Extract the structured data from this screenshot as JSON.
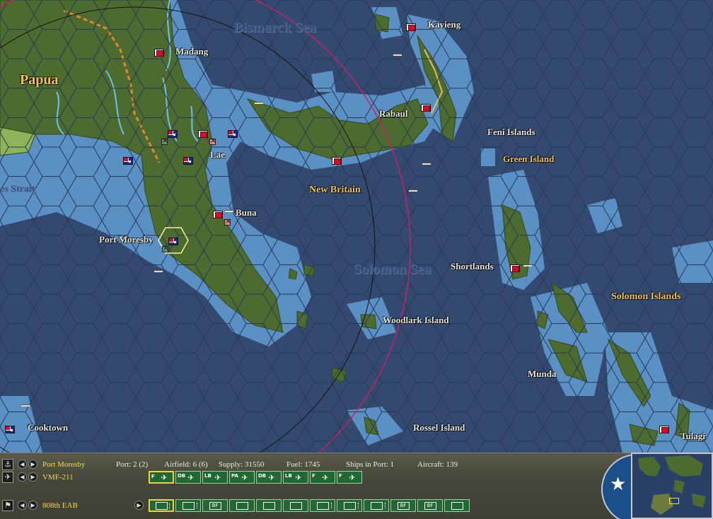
{
  "map": {
    "sea_labels": [
      "Bismarck Sea",
      "Solomon Sea"
    ],
    "region_labels": [
      "Papua",
      "New Britain",
      "Solomon Islands"
    ],
    "strait_label": "es Strait",
    "places": [
      "Madang",
      "Kavieng",
      "Rabaul",
      "Feni Islands",
      "Green Island",
      "Lae",
      "Buna",
      "Port Moresby",
      "Shortlands",
      "Woodlark Island",
      "Munda",
      "Cooktown",
      "Rossel Island",
      "Tulagi"
    ],
    "colors": {
      "deep_sea": "#34496f",
      "shallow_sea": "#5b90c4",
      "land": "#4d6b2e",
      "range_ring_red": "#c8206a",
      "range_ring_black": "#111111"
    }
  },
  "panel": {
    "base_row": {
      "name": "Port Moresby",
      "port": "Port: 2 (2)",
      "airfield": "Airfield: 6 (6)",
      "supply": "Supply: 31550",
      "fuel": "Fuel: 1745",
      "ships": "Ships in Port: 1",
      "aircraft": "Aircraft: 139"
    },
    "air_row": {
      "name": "VMF-211",
      "tiles": [
        "F",
        "DB",
        "LB",
        "PA",
        "DB",
        "LB",
        "F",
        "F"
      ]
    },
    "ground_row": {
      "name": "808th EAB",
      "tiles": [
        "",
        "",
        "BF",
        "",
        "",
        "",
        "",
        "",
        "",
        "BF",
        "BF",
        ""
      ]
    },
    "icons": [
      "anchor-icon",
      "plane-icon",
      "flag-icon",
      "arrow-left-icon",
      "arrow-right-icon"
    ]
  }
}
